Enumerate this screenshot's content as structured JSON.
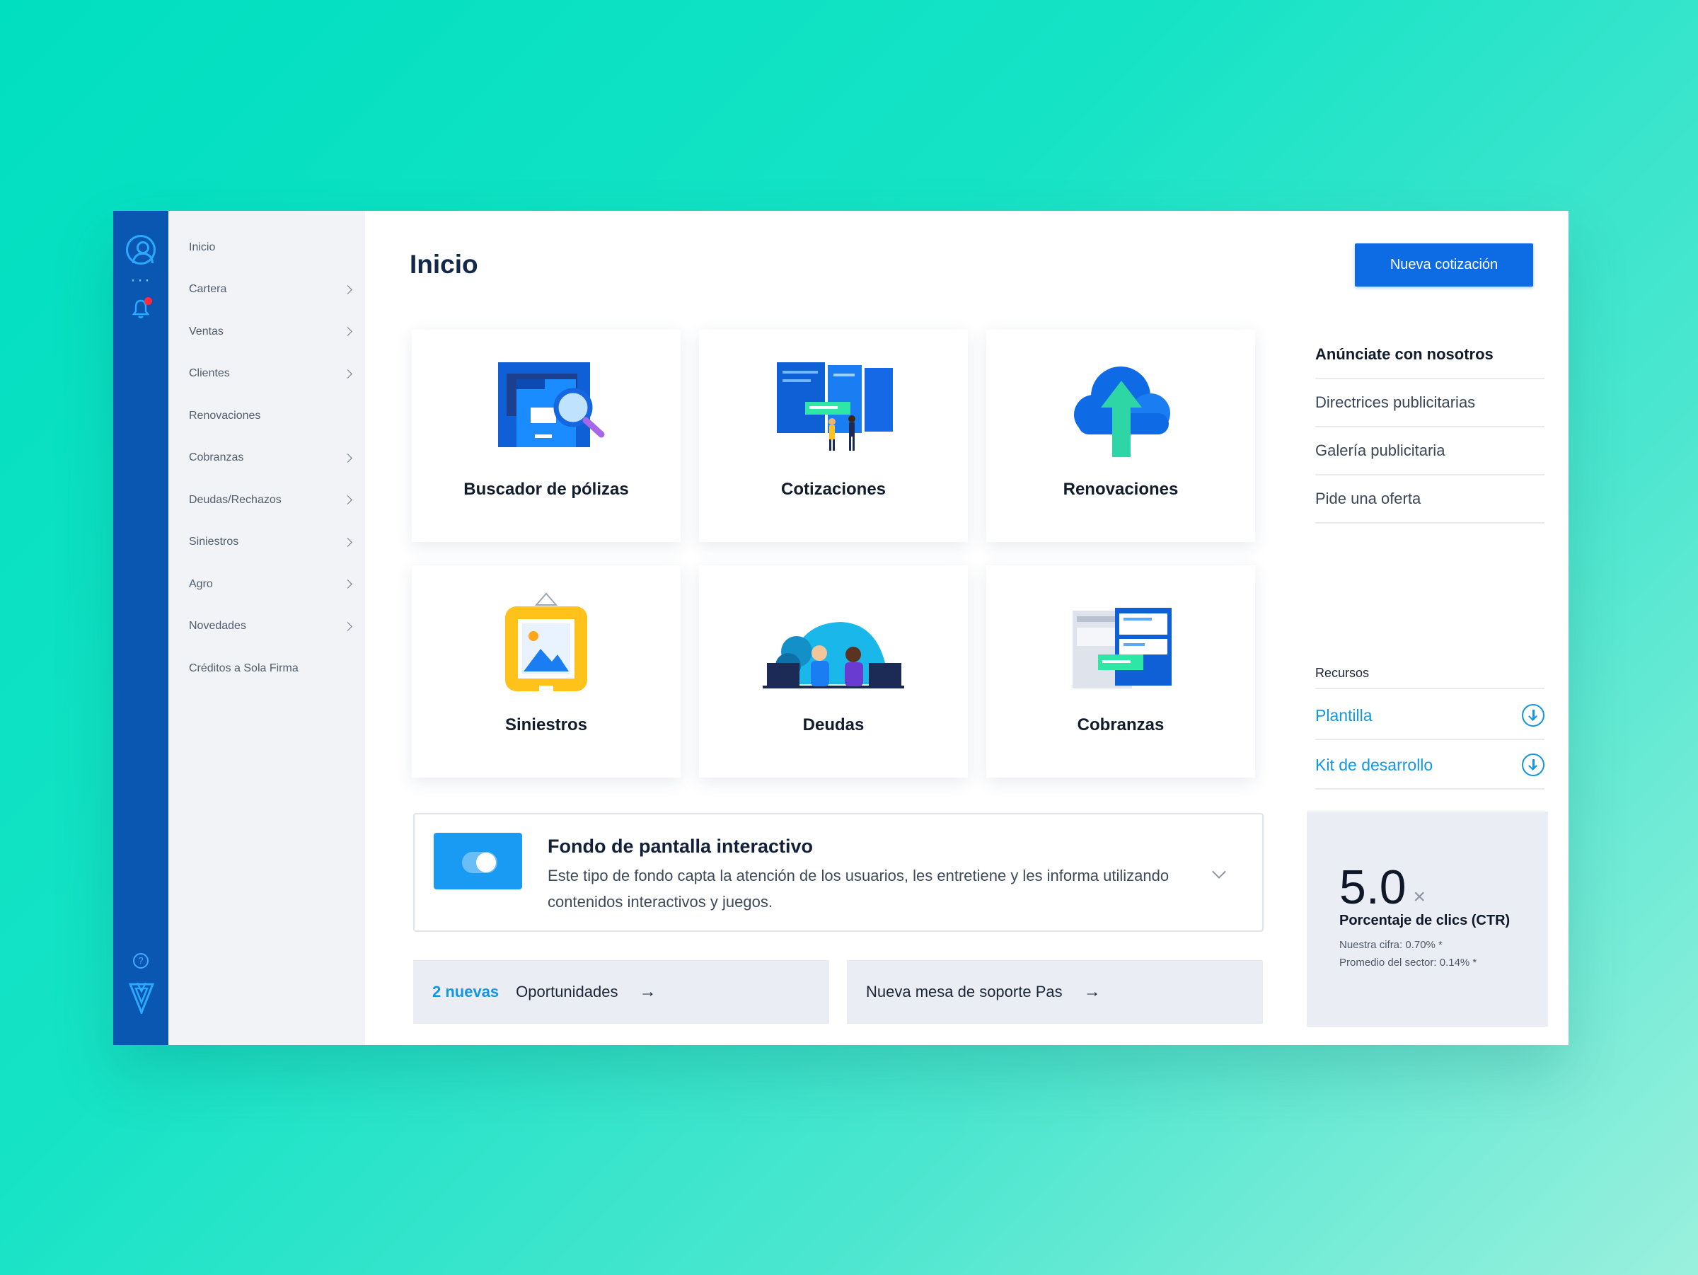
{
  "sidebar": {
    "items": [
      {
        "label": "Inicio",
        "chevron": false
      },
      {
        "label": "Cartera",
        "chevron": true
      },
      {
        "label": "Ventas",
        "chevron": true
      },
      {
        "label": "Clientes",
        "chevron": true
      },
      {
        "label": "Renovaciones",
        "chevron": false
      },
      {
        "label": "Cobranzas",
        "chevron": true
      },
      {
        "label": "Deudas/Rechazos",
        "chevron": true
      },
      {
        "label": "Siniestros",
        "chevron": true
      },
      {
        "label": "Agro",
        "chevron": true
      },
      {
        "label": "Novedades",
        "chevron": true
      },
      {
        "label": "Créditos a Sola Firma",
        "chevron": false
      }
    ]
  },
  "rail": {
    "icons": [
      "user-avatar-icon",
      "more-dots-icon",
      "bell-icon",
      "help-icon",
      "brand-logo"
    ],
    "help_glyph": "?"
  },
  "header": {
    "title": "Inicio",
    "cta_label": "Nueva cotización"
  },
  "cards": [
    {
      "label": "Buscador de pólizas",
      "icon": "folder-search-icon"
    },
    {
      "label": "Cotizaciones",
      "icon": "quotes-board-icon"
    },
    {
      "label": "Renovaciones",
      "icon": "cloud-upload-icon"
    },
    {
      "label": "Siniestros",
      "icon": "picture-frame-icon"
    },
    {
      "label": "Deudas",
      "icon": "people-desk-icon"
    },
    {
      "label": "Cobranzas",
      "icon": "collections-screens-icon"
    }
  ],
  "info_panel": {
    "title": "Fondo de pantalla interactivo",
    "description": "Este tipo de fondo capta la atención de los usuarios, les entretiene y les informa utilizando contenidos interactivos y juegos."
  },
  "bottom_bars": {
    "opportunities": {
      "highlight": "2 nuevas",
      "label": "Oportunidades",
      "arrow": "→"
    },
    "support": {
      "label": "Nueva mesa de soporte Pas",
      "arrow": "→"
    }
  },
  "right_links": [
    "Anúnciate con nosotros",
    "Directrices publicitarias",
    "Galería publicitaria",
    "Pide una oferta"
  ],
  "resources": {
    "heading": "Recursos",
    "items": [
      "Plantilla",
      "Kit de desarrollo"
    ]
  },
  "stat": {
    "value": "5.0",
    "multiplier": "×",
    "label": "Porcentaje de clics (CTR)",
    "ours": "Nuestra cifra: 0.70% *",
    "sector": "Promedio del sector: 0.14% *"
  },
  "colors": {
    "rail": "#0a57b1",
    "accent": "#0d6be4",
    "link": "#1296e6",
    "badge": "#ff2b3b"
  }
}
